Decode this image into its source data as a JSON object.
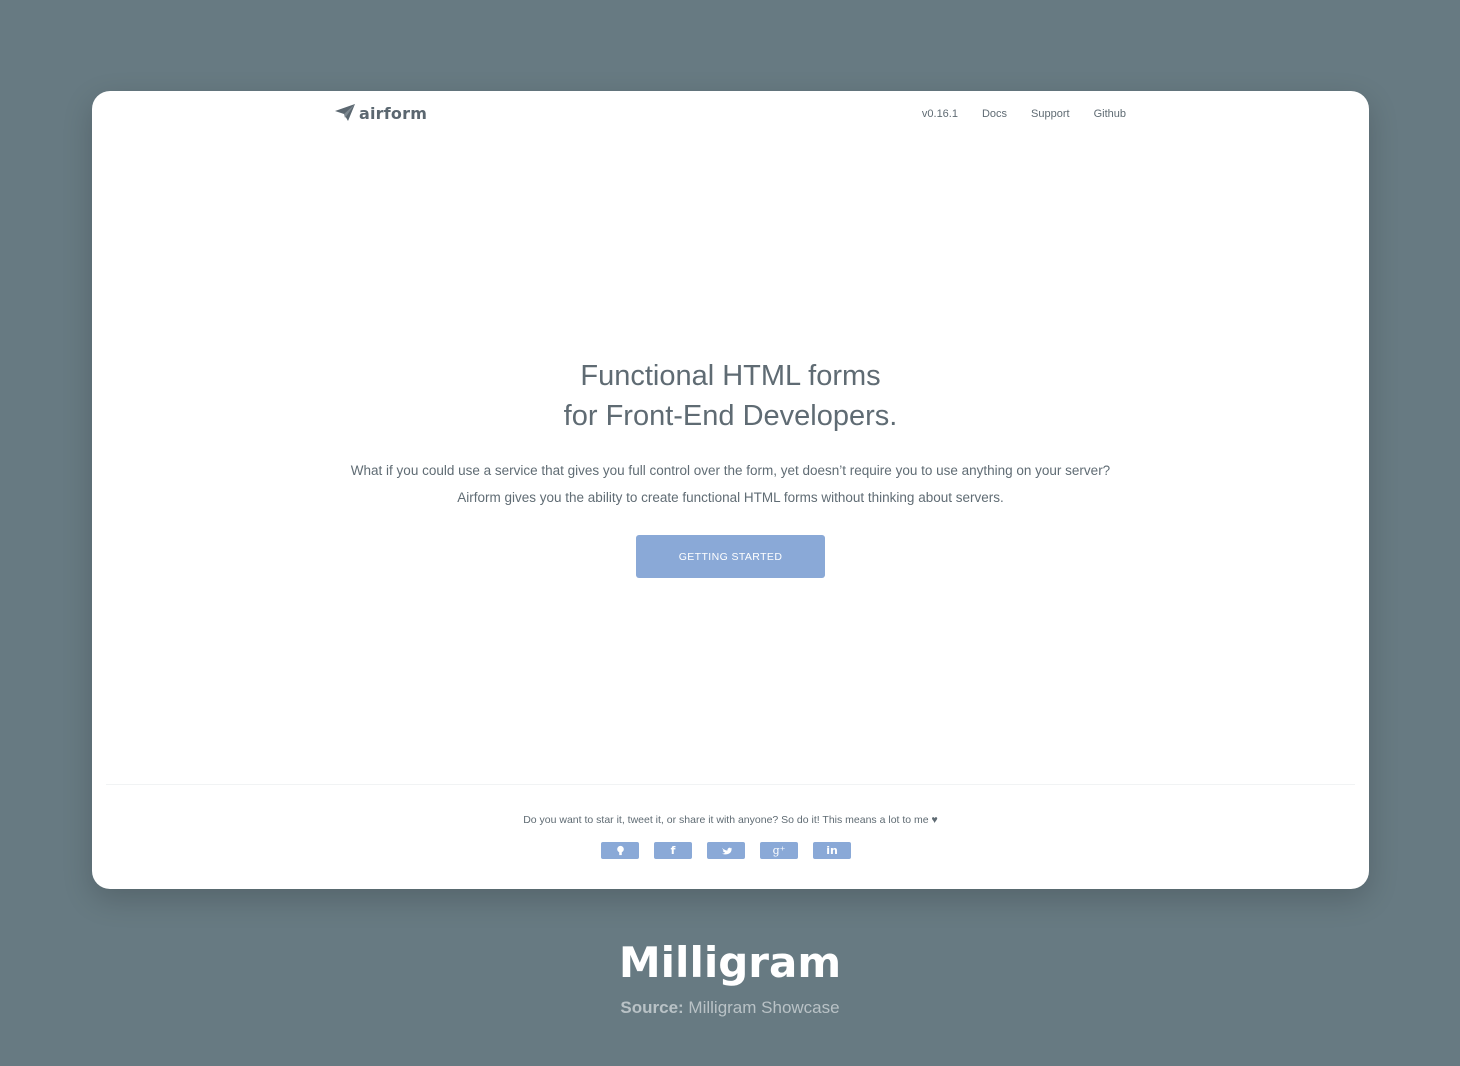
{
  "header": {
    "logo_text": "airform",
    "nav": [
      {
        "label": "v0.16.1"
      },
      {
        "label": "Docs"
      },
      {
        "label": "Support"
      },
      {
        "label": "Github"
      }
    ]
  },
  "hero": {
    "title_line1": "Functional HTML forms",
    "title_line2": "for Front-End Developers.",
    "description": "What if you could use a service that gives you full control over the form, yet doesn’t require you to use anything on your server? Airform gives you the ability to create functional HTML forms without thinking about servers.",
    "cta_label": "GETTING STARTED"
  },
  "footer": {
    "message": "Do you want to star it, tweet it, or share it with anyone? So do it! This means a lot to me",
    "heart": "♥",
    "social": [
      {
        "icon": "github-icon"
      },
      {
        "icon": "facebook-icon",
        "glyph": "f"
      },
      {
        "icon": "twitter-icon"
      },
      {
        "icon": "google-plus-icon",
        "glyph": "g⁺"
      },
      {
        "icon": "linkedin-icon",
        "glyph": "in"
      }
    ]
  },
  "caption": {
    "title": "Milligram",
    "source_label": "Source:",
    "source_value": "Milligram Showcase"
  },
  "colors": {
    "background": "#677a82",
    "card": "#ffffff",
    "accent": "#8aa9d7",
    "text": "#5f6b73"
  }
}
